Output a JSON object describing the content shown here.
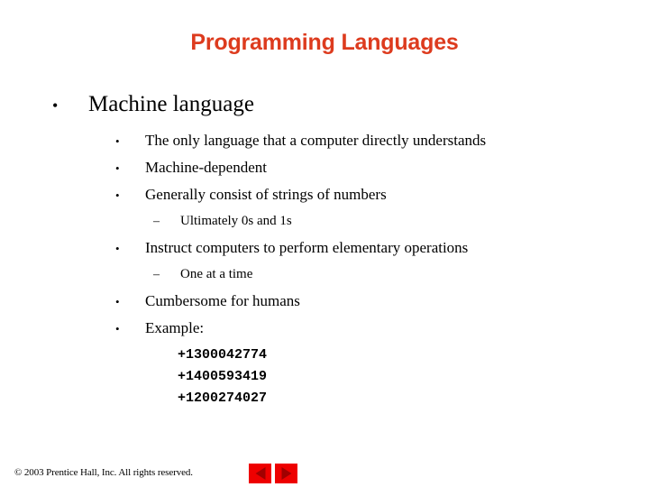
{
  "slide": {
    "title": "Programming Languages",
    "title_color": "#dd3b1e",
    "background_color": "#ffffff"
  },
  "outline": {
    "level1": {
      "marker": "•",
      "text": "Machine language"
    },
    "items": [
      {
        "level": 2,
        "marker": "•",
        "text": "The only language that a computer directly understands"
      },
      {
        "level": 2,
        "marker": "•",
        "text": "Machine-dependent"
      },
      {
        "level": 2,
        "marker": "•",
        "text": "Generally consist of strings of numbers"
      },
      {
        "level": 3,
        "marker": "–",
        "text": "Ultimately 0s and 1s"
      },
      {
        "level": 2,
        "marker": "•",
        "text": "Instruct computers to perform elementary operations"
      },
      {
        "level": 3,
        "marker": "–",
        "text": "One at a time"
      },
      {
        "level": 2,
        "marker": "•",
        "text": "Cumbersome for humans"
      },
      {
        "level": 2,
        "marker": "•",
        "text": "Example:"
      }
    ]
  },
  "code_example": {
    "lines": [
      "+1300042774",
      "+1400593419",
      "+1200274027"
    ]
  },
  "footer": {
    "copyright": "© 2003 Prentice Hall, Inc.  All rights reserved."
  },
  "navigation": {
    "previous_label": "previous-slide",
    "next_label": "next-slide",
    "button_color": "#ee0000",
    "arrow_color": "#a00000"
  }
}
